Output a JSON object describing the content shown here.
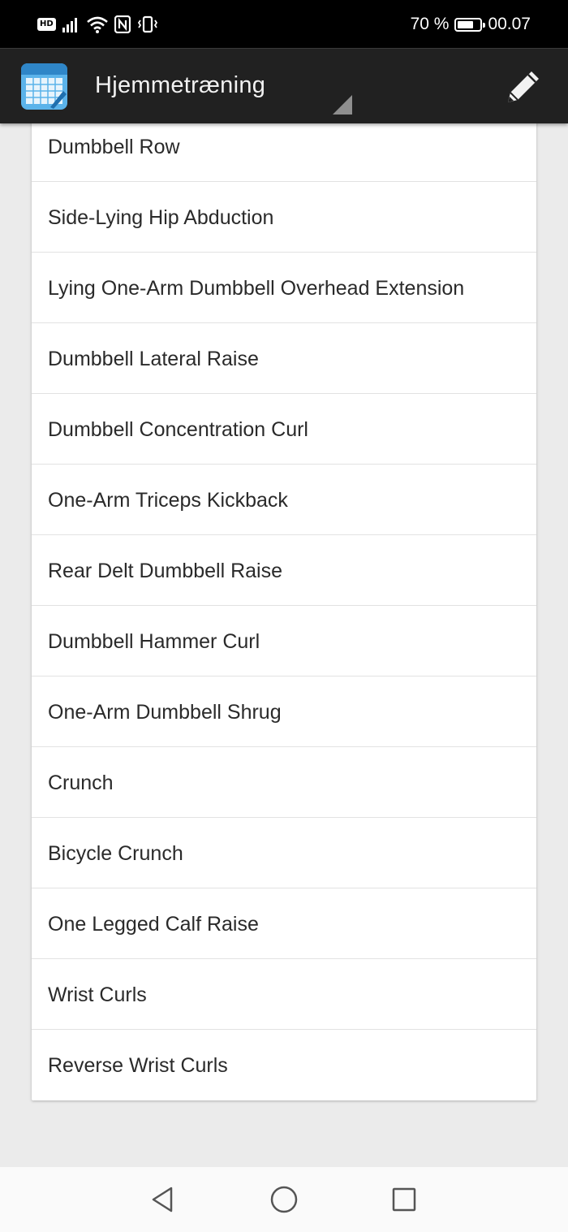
{
  "status_bar": {
    "hd_label": "HD",
    "battery_text": "70 %",
    "battery_level": 0.7,
    "time": "00.07"
  },
  "action_bar": {
    "title": "Hjemmetræning",
    "app_icon": "calendar-app-icon",
    "edit_icon": "pencil-icon"
  },
  "exercises": [
    "Dumbbell Row",
    "Side-Lying Hip Abduction",
    "Lying One-Arm Dumbbell Overhead Extension",
    "Dumbbell Lateral Raise",
    "Dumbbell Concentration Curl",
    "One-Arm Triceps Kickback",
    "Rear Delt Dumbbell Raise",
    "Dumbbell Hammer Curl",
    "One-Arm Dumbbell Shrug",
    "Crunch",
    "Bicycle Crunch",
    "One Legged Calf Raise",
    "Wrist Curls",
    "Reverse Wrist Curls"
  ],
  "nav_bar": {
    "back_icon": "triangle-back-icon",
    "home_icon": "circle-home-icon",
    "recents_icon": "square-recents-icon"
  },
  "colors": {
    "status_bar_bg": "#000000",
    "action_bar_bg": "#212121",
    "page_bg": "#ebebeb",
    "list_bg": "#ffffff",
    "app_icon_blue": "#3b9bd6"
  }
}
